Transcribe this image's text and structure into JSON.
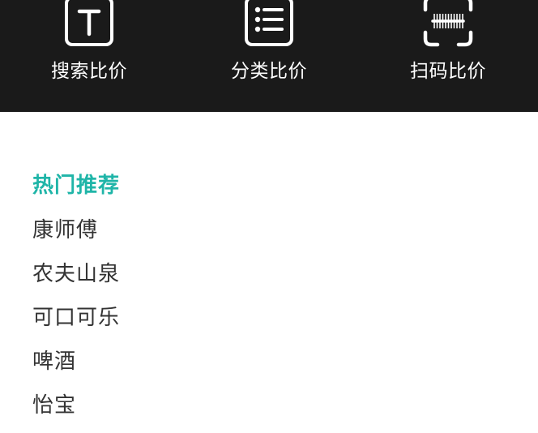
{
  "top_actions": [
    {
      "label": "搜索比价",
      "icon": "text-search-icon"
    },
    {
      "label": "分类比价",
      "icon": "list-icon"
    },
    {
      "label": "扫码比价",
      "icon": "barcode-scan-icon"
    }
  ],
  "hot": {
    "title": "热门推荐",
    "items": [
      "康师傅",
      "农夫山泉",
      "可口可乐",
      "啤酒",
      "怡宝"
    ]
  },
  "colors": {
    "top_bar_bg": "#1a1a1a",
    "accent": "#1fb5a8",
    "text": "#333333"
  }
}
